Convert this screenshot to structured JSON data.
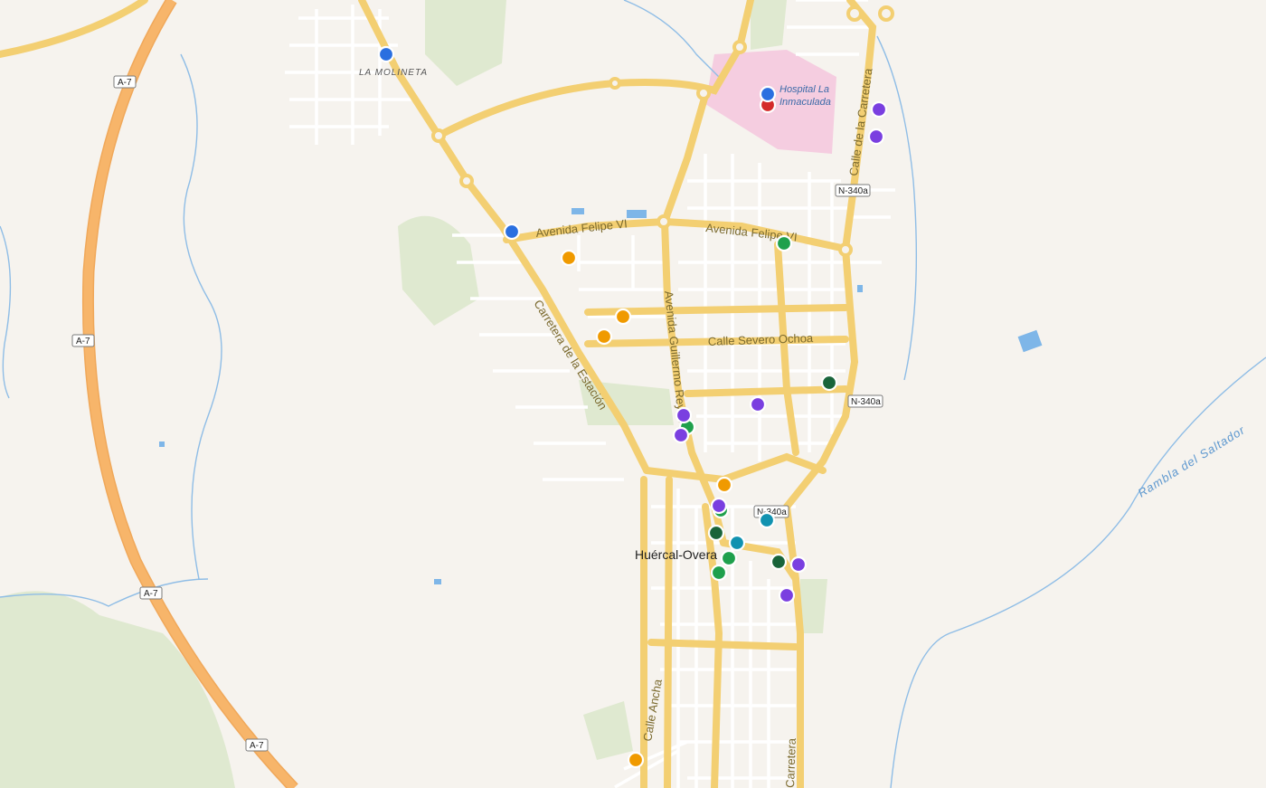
{
  "map": {
    "place_labels": {
      "molineta": "LA MOLINETA",
      "town": "Huércal-Overa",
      "hospital": "Hospital La Inmaculada"
    },
    "street_labels": {
      "felipe_west": "Avenida Felipe VI",
      "felipe_east": "Avenida Felipe VI",
      "estacion": "Carretera de la Estación",
      "guillermo": "Avenida Guillermo Reyes",
      "severo": "Calle Severo Ochoa",
      "carretera_ne": "Calle de la Carretera",
      "carretera_s": "Carretera",
      "ancha": "Calle Ancha",
      "rambla": "Rambla del Saltador"
    },
    "road_shields": {
      "a7_1": "A-7",
      "a7_2": "A-7",
      "a7_3": "A-7",
      "a7_4": "A-7",
      "n340a_1": "N-340a",
      "n340a_2": "N-340a",
      "n340a_3": "N-340a"
    },
    "marker_colors": {
      "blue": "#2a6fe0",
      "red": "#d42a2a",
      "orange": "#f09a00",
      "green": "#1fa04c",
      "darkgreen": "#19643a",
      "purple": "#7a3fe0",
      "teal": "#1192b0"
    },
    "colors": {
      "background": "#f6f3ee",
      "highway": "#f5b064",
      "main_road": "#f8d78a",
      "water": "#7eb6e8",
      "park": "#dde9cf",
      "hospital": "#f6cfe0"
    }
  }
}
